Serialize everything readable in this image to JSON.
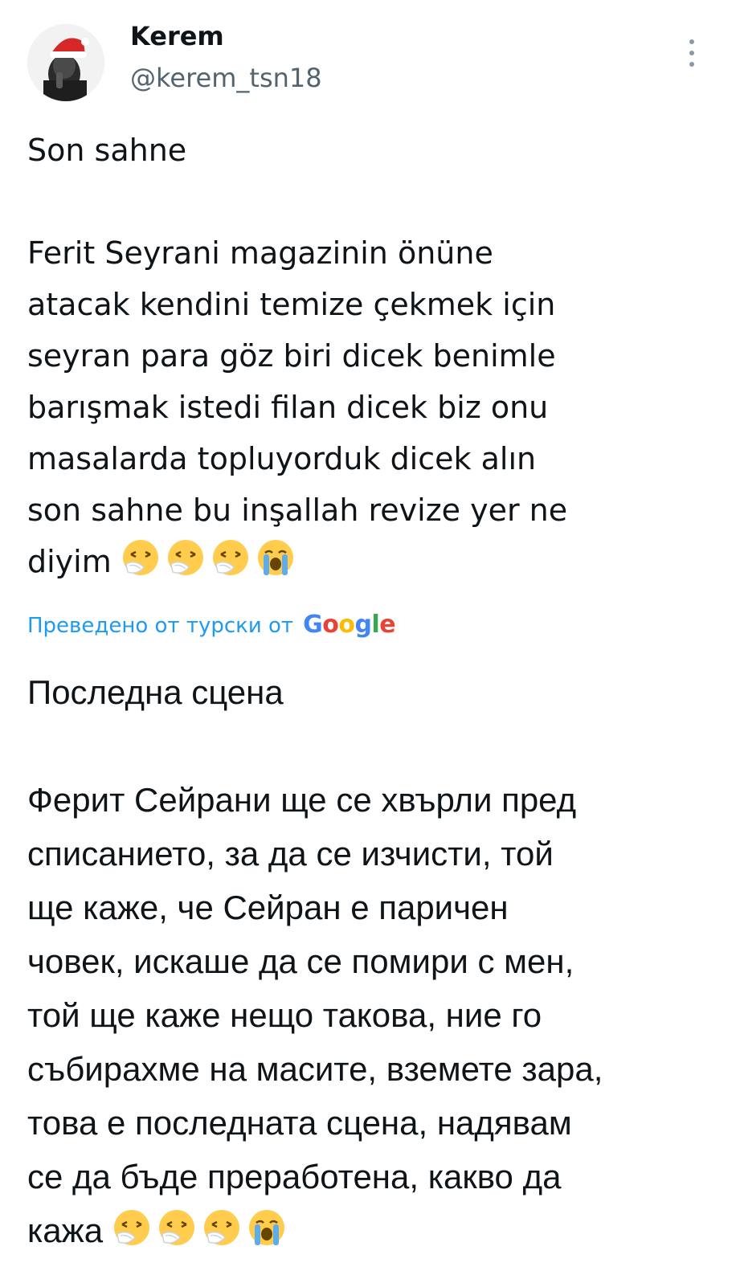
{
  "author": {
    "name": "Kerem",
    "handle": "@kerem_tsn18"
  },
  "tweet": {
    "text": "Son sahne\n\nFerit Seyrani magazinin önüne\natacak kendini temize çekmek için\nseyran para göz biri dicek benimle\nbarışmak istedi filan dicek biz onu\nmasalarda topluyorduk dicek alın\nson sahne bu inşallah revize yer ne\ndiyim",
    "emojis": [
      "sneezing-face",
      "sneezing-face",
      "sneezing-face",
      "loudly-crying-face"
    ]
  },
  "translation": {
    "label": "Преведено от турски от",
    "provider": "Google",
    "text": "Последна сцена\n\nФерит Сейрани ще се хвърли пред\nсписанието, за да се изчисти, той\nще каже, че Сейран е паричен\nчовек, искаше да се помири с мен,\nтой ще каже нещо такова, ние го\nсъбирахме на масите, вземете зара,\nтова е последната сцена, надявам\nсе да бъде преработена, какво да\nкажа",
    "emojis": [
      "sneezing-face",
      "sneezing-face",
      "sneezing-face",
      "loudly-crying-face"
    ]
  },
  "icons": {
    "more": "more-vertical-icon",
    "avatar": "avatar"
  }
}
